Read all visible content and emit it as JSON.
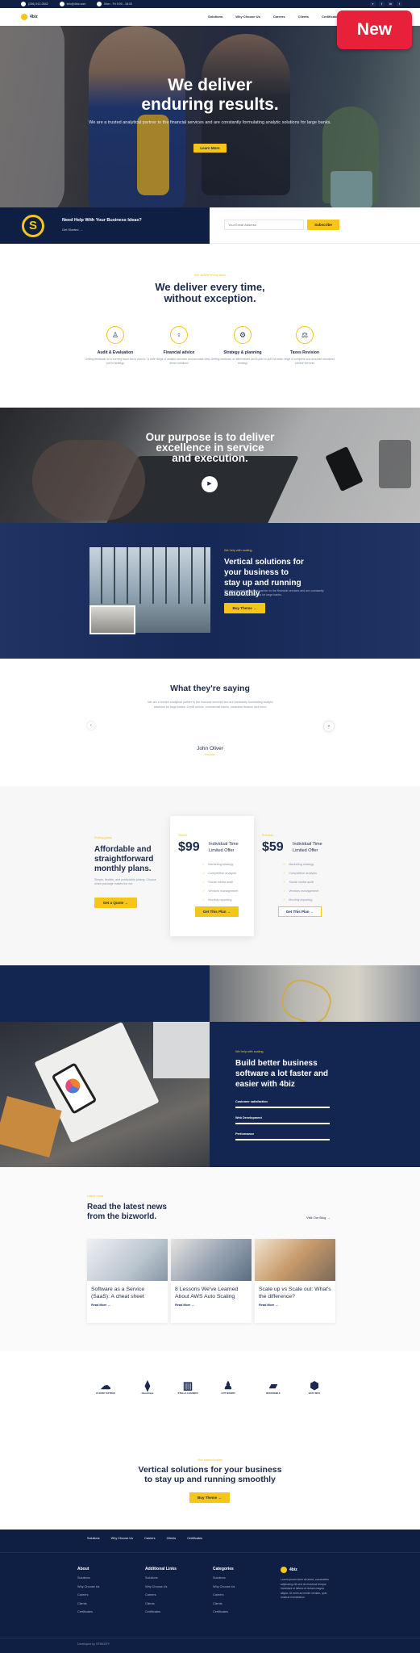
{
  "topbar": {
    "phone": "(256) 512-0542",
    "email": "info@4biz.com",
    "hours": "Mon - Fri 9:00 - 18:00",
    "social_icons": [
      "search-icon",
      "facebook-icon",
      "linkedin-icon",
      "twitter-icon"
    ]
  },
  "nav": {
    "logo": "4biz",
    "items": [
      "Solutions",
      "Why Choose Us",
      "Careers",
      "Clients",
      "Certificates"
    ]
  },
  "badge": "New",
  "hero": {
    "title_line1": "We deliver",
    "title_line2": "enduring results.",
    "subtitle": "We are a trusted analytical partner to the financial services and are constantly formulating analytic solutions for large banks.",
    "button": "Learn More"
  },
  "help": {
    "title": "Need Help With Your Business Ideas?",
    "link": "Get Started",
    "email_placeholder": "Your Email Address",
    "subscribe": "Subscribe"
  },
  "features": {
    "eyebrow": "We deliver every time",
    "title_line1": "We deliver every time,",
    "title_line2": "without exception.",
    "items": [
      {
        "icon": "audit-icon",
        "title": "Audit & Evaluation",
        "desc": "Getting feedback on a burning issue and a plan to pull in strategy"
      },
      {
        "icon": "advice-icon",
        "title": "Financial advice",
        "desc": "A wide range of analytic services and accurate data-driven solutions"
      },
      {
        "icon": "strategy-icon",
        "title": "Strategy & planning",
        "desc": "Getting feedback on alternatives and a plan to pull in strategy"
      },
      {
        "icon": "taxes-icon",
        "title": "Taxes Revision",
        "desc": "A wide range of complete and accurate structured precise services"
      }
    ]
  },
  "purpose": {
    "line1": "Our purpose is to deliver",
    "line2": "excellence in service",
    "line3": "and execution."
  },
  "vertical": {
    "eyebrow": "We help with scaling",
    "title": "Vertical solutions for your business to stay up and running smoothly",
    "desc": "We are a trusted analytical partner to the financial services and are constantly formulating analytic solutions for large banks.",
    "button": "Buy Theme"
  },
  "testimonials": {
    "title": "What they're saying",
    "quote": "We are a trusted analytical partner to the financial services and are constantly formulating analytic solutions for large banks. Credit unions, commercial banks, consumer finance and more.",
    "name": "John Oliver",
    "role": "Founder"
  },
  "pricing": {
    "eyebrow": "Pricing plans",
    "title": "Affordable and straightforward monthly plans.",
    "desc": "Simple, flexible, and predictable pricing. Choose which package makes the cut.",
    "button": "Get a Quote",
    "plans": [
      {
        "label": "Starter",
        "price": "$99",
        "name": "Individual Time Limited Offer",
        "features": [
          "Marketing strategy",
          "Competitive analysis",
          "Social media audit",
          "Vendors management",
          "Monthly reporting"
        ],
        "button": "Get This Plan"
      },
      {
        "label": "Premium",
        "price": "$59",
        "name": "Individual Time Limited Offer",
        "features": [
          "Marketing strategy",
          "Competitive analysis",
          "Social media audit",
          "Vendors management",
          "Monthly reporting"
        ],
        "button": "Get This Plan"
      }
    ]
  },
  "build": {
    "eyebrow": "We help with scaling",
    "title": "Build better business software a lot faster and easier with 4biz",
    "bars": [
      "Customer satisfaction",
      "Web Development",
      "Performance"
    ]
  },
  "news": {
    "eyebrow": "Latest news",
    "title_line1": "Read the latest news",
    "title_line2": "from the bizworld.",
    "visit": "Visit Our Blog",
    "posts": [
      {
        "title": "Software as a Service (SaaS): A cheat sheet",
        "link": "Read More"
      },
      {
        "title": "8 Lessons We've Learned About AWS Auto Scaling",
        "link": "Read More"
      },
      {
        "title": "Scale up vs Scale out: What's the difference?",
        "link": "Read More"
      }
    ]
  },
  "logos": [
    "CLOUDY EXTRAS",
    "NoreeCape",
    "STELLA LEADERS",
    "OUT BOARD",
    "BOOKSHELF",
    "EASY BOX"
  ],
  "cta": {
    "eyebrow": "Get started today",
    "line1": "Vertical solutions for your business",
    "line2": "to stay up and running smoothly",
    "button": "Buy Theme"
  },
  "footer": {
    "nav": [
      "Solutions",
      "Why Choose Us",
      "Careers",
      "Clients",
      "Certificates"
    ],
    "columns": [
      {
        "title": "About",
        "items": [
          "Solutions",
          "Why Choose Us",
          "Careers",
          "Clients",
          "Certificates"
        ]
      },
      {
        "title": "Additional Links",
        "items": [
          "Solutions",
          "Why Choose Us",
          "Careers",
          "Clients",
          "Certificates"
        ]
      },
      {
        "title": "Categories",
        "items": [
          "Solutions",
          "Why Choose Us",
          "Careers",
          "Clients",
          "Certificates"
        ]
      }
    ],
    "brand": "4biz",
    "brand_desc": "Lorem ipsum dolor sit amet, consectetur adipiscing elit sed do eiusmod tempor incididunt ut labore et dolore magna aliqua. Ut enim ad minim veniam, quis nostrud exercitation.",
    "developed": "Developed by STRATIFY"
  },
  "colors": {
    "navy": "#0f1f44",
    "yellow": "#f5c518",
    "red": "#e8213a"
  }
}
